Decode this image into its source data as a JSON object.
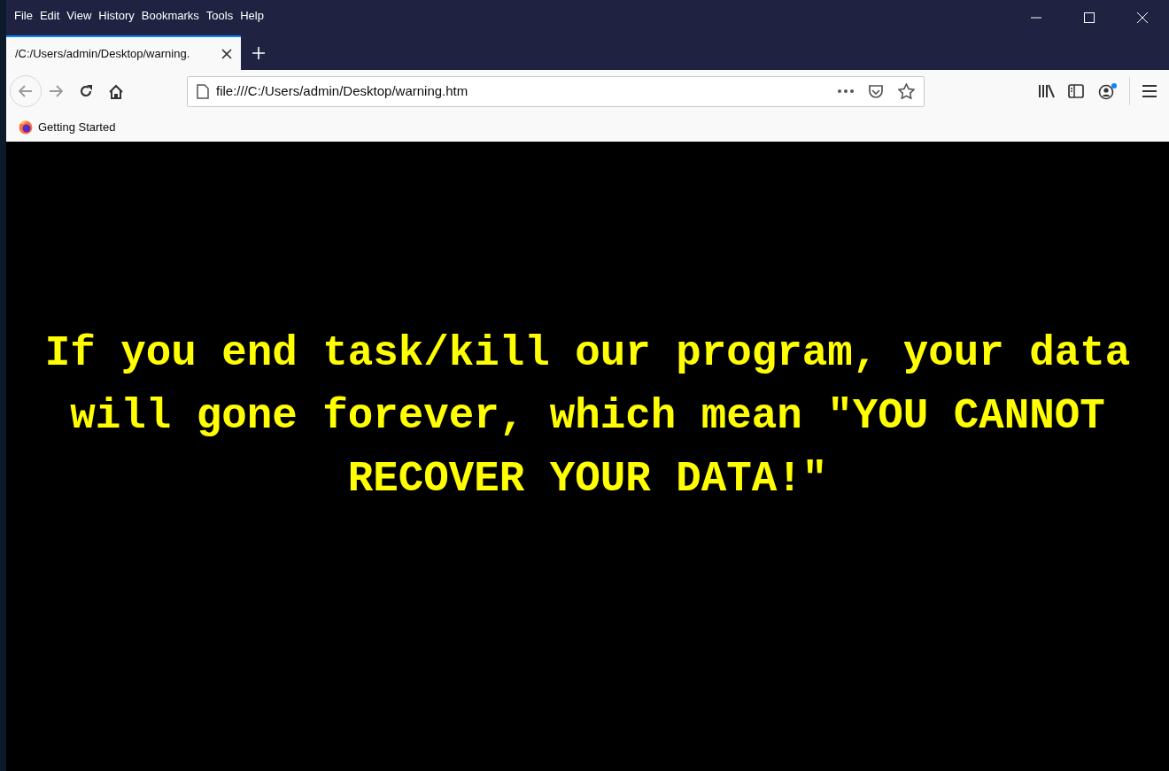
{
  "menu": [
    "File",
    "Edit",
    "View",
    "History",
    "Bookmarks",
    "Tools",
    "Help"
  ],
  "tabs": [
    {
      "title": "/C:/Users/admin/Desktop/warning.",
      "selected": true
    }
  ],
  "address_bar": {
    "value": "file:///C:/Users/admin/Desktop/warning.htm"
  },
  "bookmarks": [
    "Getting Started"
  ],
  "page": {
    "message": "If you end task/kill our program, your data will gone forever, which mean \"YOU CANNOT RECOVER YOUR DATA!\""
  }
}
